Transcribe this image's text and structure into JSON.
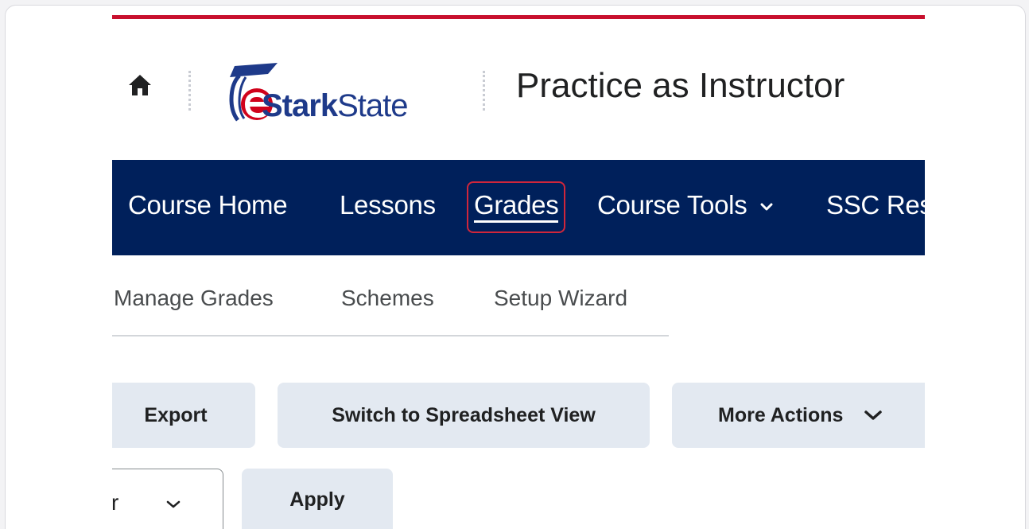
{
  "header": {
    "logo_text_bold": "Stark",
    "logo_text_light": "State",
    "course_title": "Practice as Instructor"
  },
  "nav": {
    "items": [
      {
        "label": "Course Home"
      },
      {
        "label": "Lessons"
      },
      {
        "label": "Grades"
      },
      {
        "label": "Course Tools"
      },
      {
        "label": "SSC Res"
      }
    ]
  },
  "subtabs": [
    {
      "label": "Manage Grades"
    },
    {
      "label": "Schemes"
    },
    {
      "label": "Setup Wizard"
    }
  ],
  "actions": {
    "export": "Export",
    "switch_view": "Switch to Spreadsheet View",
    "more_actions": "More Actions",
    "apply": "Apply"
  },
  "filter": {
    "selected_value": "r"
  },
  "colors": {
    "accent_red": "#c8102e",
    "navbar": "#00205b",
    "button_bg": "#e3e9f1",
    "highlight_border": "#d0263b"
  },
  "icons": {
    "home": "home-icon",
    "logo": "graduation-cap-logo",
    "dropdown": "chevron-down-icon"
  }
}
